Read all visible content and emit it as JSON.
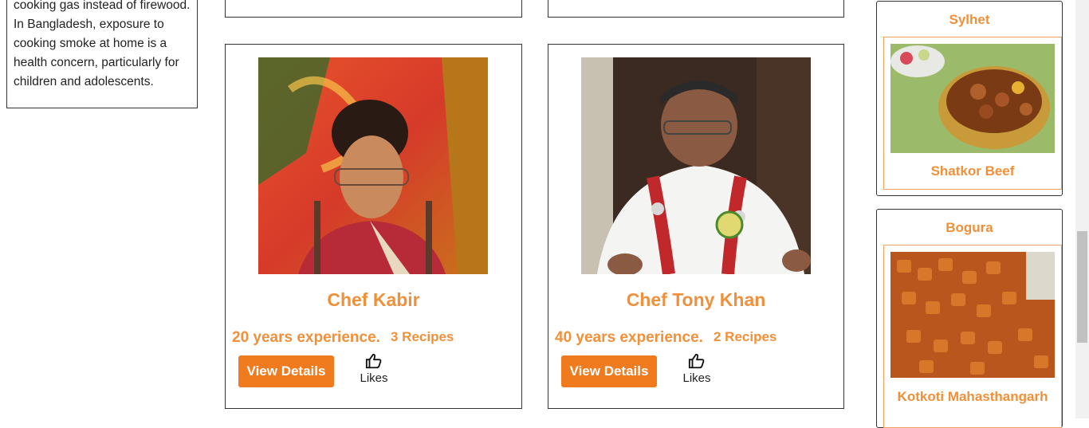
{
  "intro": {
    "text": "cooking gas instead of firewood. In Bangladesh, exposure to cooking smoke at home is a health concern, particularly for children and adolescents."
  },
  "chefs": [
    {
      "name": "Chef Kabir",
      "experience": "20 years experience.",
      "recipes": "3 Recipes",
      "button_label": "View Details",
      "likes_label": "Likes",
      "photo_icon": "chef-portrait-photo"
    },
    {
      "name": "Chef Tony Khan",
      "experience": "40 years experience.",
      "recipes": "2 Recipes",
      "button_label": "View Details",
      "likes_label": "Likes",
      "photo_icon": "chef-portrait-photo"
    }
  ],
  "regions": [
    {
      "region": "Sylhet",
      "dish": "Shatkor Beef"
    },
    {
      "region": "Bogura",
      "dish": "Kotkoti Mahasthangarh"
    }
  ],
  "colors": {
    "accent": "#f0903a",
    "button": "#f07a1e",
    "border": "#333333"
  }
}
